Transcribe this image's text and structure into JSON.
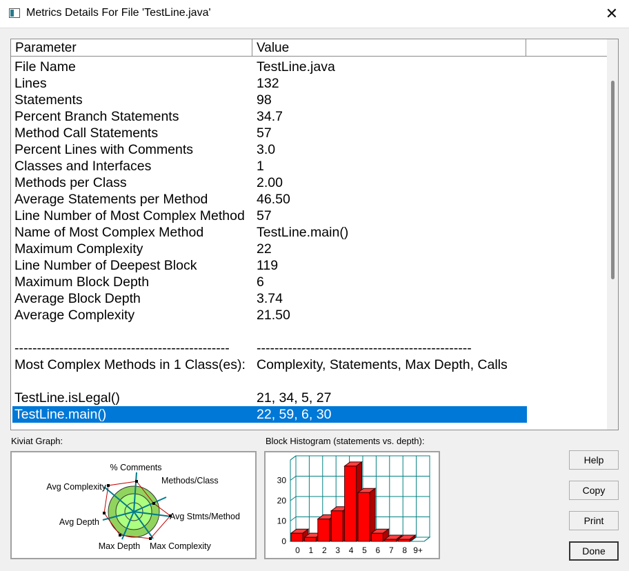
{
  "window": {
    "title": "Metrics Details For File 'TestLine.java'",
    "close_glyph": "✕"
  },
  "table": {
    "headers": [
      "Parameter",
      "Value"
    ],
    "rows": [
      [
        "File Name",
        "TestLine.java"
      ],
      [
        "Lines",
        "132"
      ],
      [
        "Statements",
        "98"
      ],
      [
        "Percent Branch Statements",
        "34.7"
      ],
      [
        "Method Call Statements",
        "57"
      ],
      [
        "Percent Lines with Comments",
        "3.0"
      ],
      [
        "Classes and Interfaces",
        "1"
      ],
      [
        "Methods per Class",
        "2.00"
      ],
      [
        "Average Statements per Method",
        "46.50"
      ],
      [
        "Line Number of Most Complex Method",
        "57"
      ],
      [
        "Name of Most Complex Method",
        "TestLine.main()"
      ],
      [
        "Maximum Complexity",
        "22"
      ],
      [
        "Line Number of Deepest Block",
        "119"
      ],
      [
        "Maximum Block Depth",
        "6"
      ],
      [
        "Average Block Depth",
        "3.74"
      ],
      [
        "Average Complexity",
        "21.50"
      ],
      [
        "",
        ""
      ],
      [
        "------------------------------------------------",
        "------------------------------------------------"
      ],
      [
        "Most Complex Methods in 1 Class(es):",
        "Complexity, Statements, Max Depth, Calls"
      ],
      [
        "",
        ""
      ],
      [
        "TestLine.isLegal()",
        "21, 34, 5, 27"
      ],
      [
        "TestLine.main()",
        "22, 59, 6, 30"
      ]
    ],
    "selected_row": 21
  },
  "kiviat": {
    "label": "Kiviat Graph:",
    "axes": [
      "% Comments",
      "Methods/Class",
      "Avg Stmts/Method",
      "Max Complexity",
      "Max Depth",
      "Avg Depth",
      "Avg Complexity"
    ],
    "colors": {
      "inner": "#adff80",
      "ring": "#90d45e",
      "spoke": "#007a8c",
      "outline": "#c00000"
    }
  },
  "histogram": {
    "label": "Block Histogram (statements vs. depth):",
    "chart_data": {
      "type": "bar",
      "categories": [
        "0",
        "1",
        "2",
        "3",
        "4",
        "5",
        "6",
        "7",
        "8",
        "9+"
      ],
      "values": [
        4,
        2,
        11,
        15,
        37,
        24,
        4,
        1,
        1,
        0
      ],
      "ylim": [
        0,
        40
      ],
      "yticks": [
        0,
        10,
        20,
        30
      ],
      "grid": true,
      "bar_color": "#ff0000",
      "grid_color": "#008080"
    }
  },
  "buttons": {
    "help": "Help",
    "copy": "Copy",
    "print": "Print",
    "done": "Done"
  }
}
